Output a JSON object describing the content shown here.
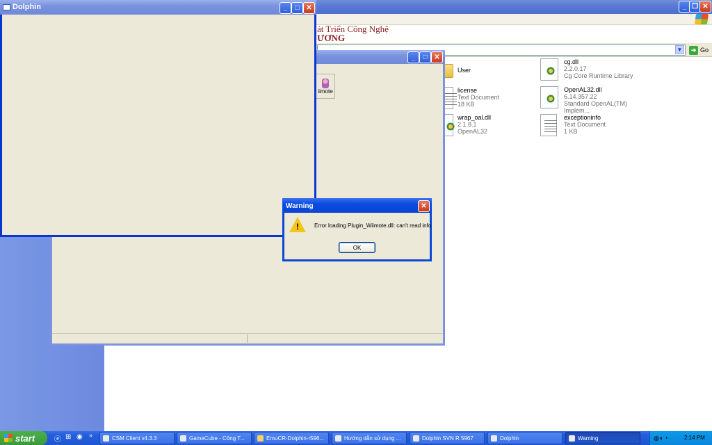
{
  "background_window": {
    "heading_line_1": "át Triển Công Nghệ",
    "heading_line_2": "ƯƠNG",
    "address_partial": "",
    "go_label": "Go",
    "files": [
      {
        "name": "User",
        "type": "folder",
        "line2": "",
        "line3": ""
      },
      {
        "name": "cg.dll",
        "type": "dll",
        "line2": "2.2.0.17",
        "line3": "Cg Core Runtime Library"
      },
      {
        "name": "license",
        "type": "text",
        "line2": "Text Document",
        "line3": "18 KB"
      },
      {
        "name": "OpenAL32.dll",
        "type": "dll",
        "line2": "6.14.357.22",
        "line3": "Standard OpenAL(TM) Implem..."
      },
      {
        "name": "wrap_oal.dll",
        "type": "dll",
        "line2": "2.1.8.1",
        "line3": "OpenAL32"
      },
      {
        "name": "exceptioninfo",
        "type": "text",
        "line2": "Text Document",
        "line3": "1 KB"
      }
    ]
  },
  "dolphin_window": {
    "title": "Dolphin",
    "controls": [
      "minimize-icon",
      "maximize-icon",
      "close-icon"
    ]
  },
  "config_window": {
    "wiimote_button_label": "iimote"
  },
  "dialog": {
    "title": "Warning",
    "message": "Error loading Plugin_Wiimote.dll: can't read info",
    "ok_label": "OK",
    "icon": "warning-icon"
  },
  "taskbar": {
    "start_label": "start",
    "chevron": "»",
    "tasks": [
      {
        "label": "CSM Client v4.3.3",
        "icon": "app-icon"
      },
      {
        "label": "GameCube - Công T...",
        "icon": "ie-icon"
      },
      {
        "label": "EmuCR-Dolphin-r596...",
        "icon": "folder-icon"
      },
      {
        "label": "Hướng dẫn sử dụng ...",
        "icon": "ie-icon"
      },
      {
        "label": "Dolphin SVN R 5967",
        "icon": "dolphin-icon"
      },
      {
        "label": "Dolphin",
        "icon": "dolphin-icon"
      },
      {
        "label": "Warning",
        "icon": "dolphin-icon"
      }
    ],
    "active_task": "Warning",
    "clock": "2:14 PM"
  },
  "colors": {
    "title_active": "#0b4ce0",
    "title_inactive": "#7a93df",
    "taskbar": "#245edb",
    "start_green": "#3a9a3a",
    "heading_red": "#8b1a1a"
  }
}
